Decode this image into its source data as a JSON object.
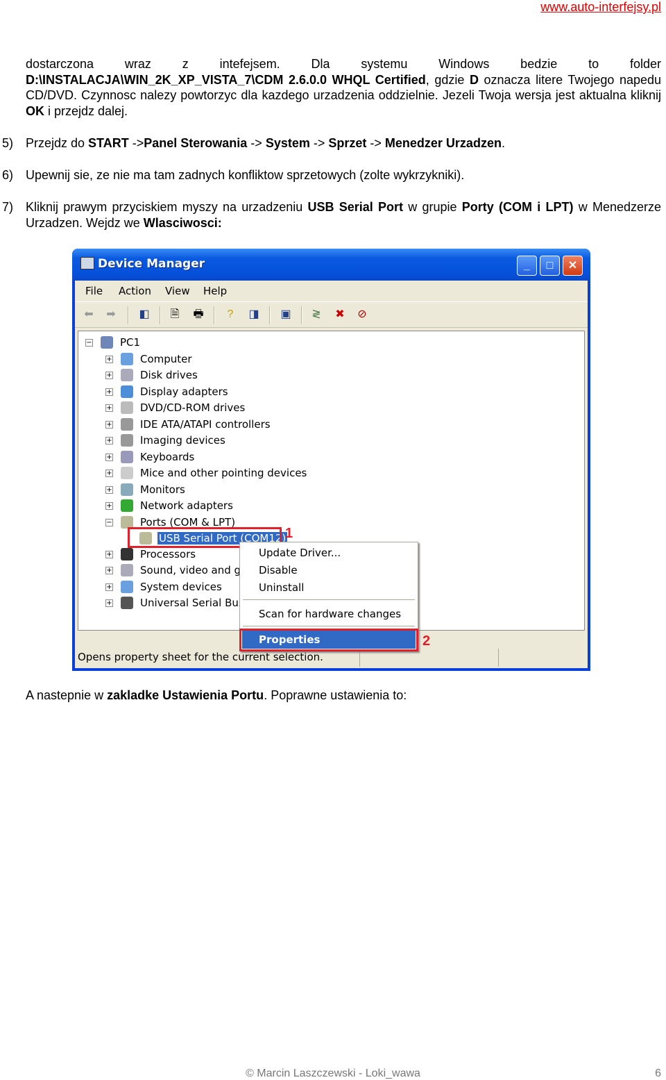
{
  "header": {
    "link": "www.auto-interfejsy.pl"
  },
  "paragraphs": [
    [
      {
        "t": "dostarczona wraz z intefejsem. Dla systemu Windows bedzie to folder "
      },
      {
        "t": "D:\\INSTALACJA\\WIN_2K_XP_VISTA_7\\CDM 2.6.0.0 WHQL Certified",
        "b": true
      },
      {
        "t": ", gdzie "
      },
      {
        "t": "D",
        "b": true
      },
      {
        "t": " oznacza litere Twojego napedu CD/DVD. Czynnosc nalezy powtorzyc dla kazdego urzadzenia oddzielnie. Jezeli Twoja wersja jest aktualna kliknij "
      },
      {
        "t": "OK",
        "b": true
      },
      {
        "t": " i przejdz dalej."
      }
    ]
  ],
  "steps": [
    {
      "num": "5)",
      "segs": [
        {
          "t": "Przejdz do "
        },
        {
          "t": "START",
          "b": true
        },
        {
          "t": " ->"
        },
        {
          "t": "Panel Sterowania ",
          "b": true
        },
        {
          "t": " -> "
        },
        {
          "t": "System",
          "b": true
        },
        {
          "t": " -> "
        },
        {
          "t": "Sprzet",
          "b": true
        },
        {
          "t": " -> "
        },
        {
          "t": "Menedzer Urzadzen",
          "b": true
        },
        {
          "t": "."
        }
      ]
    },
    {
      "num": "6)",
      "segs": [
        {
          "t": "Upewnij sie, ze nie ma tam zadnych konfliktow sprzetowych (zolte wykrzykniki)."
        }
      ]
    },
    {
      "num": "7)",
      "segs": [
        {
          "t": "Kliknij prawym przyciskiem myszy na urzadzeniu "
        },
        {
          "t": "USB Serial Port",
          "b": true
        },
        {
          "t": " w grupie "
        },
        {
          "t": "Porty (COM i LPT)",
          "b": true
        },
        {
          "t": " w Menedzerze Urzadzen. Wejdz we "
        },
        {
          "t": "Wlasciwosci:",
          "b": true
        }
      ]
    }
  ],
  "window": {
    "title": "Device Manager",
    "menu": [
      "File",
      "Action",
      "View",
      "Help"
    ],
    "toolbar_icons": [
      "back-arrow-icon",
      "forward-arrow-icon",
      "show-hide-tree-icon",
      "properties-icon",
      "print-icon",
      "help-icon",
      "show-hide-action-pane-icon",
      "update-driver-icon",
      "scan-hardware-icon",
      "uninstall-icon",
      "disable-icon"
    ],
    "tree_root": "PC1",
    "tree": [
      "Computer",
      "Disk drives",
      "Display adapters",
      "DVD/CD-ROM drives",
      "IDE ATA/ATAPI controllers",
      "Imaging devices",
      "Keyboards",
      "Mice and other pointing devices",
      "Monitors",
      "Network adapters",
      "Ports (COM & LPT)"
    ],
    "selected": "USB Serial Port (COM12)",
    "tree_after": [
      "Processors",
      "Sound, video and ga",
      "System devices",
      "Universal Serial Bus c"
    ],
    "context_menu": [
      "Update Driver...",
      "Disable",
      "Uninstall",
      "Scan for hardware changes",
      "Properties"
    ],
    "status": "Opens property sheet for the current selection.",
    "markers": [
      "1",
      "2"
    ],
    "colors": {
      "title_bar": "#0a5ae0",
      "highlight": "#316ac5",
      "marker": "#e0202a"
    }
  },
  "after": [
    {
      "t": "A nastepnie w "
    },
    {
      "t": "zakladke Ustawienia Portu",
      "b": true
    },
    {
      "t": ". Poprawne ustawienia to:"
    }
  ],
  "footer": {
    "text": "© Marcin Laszczewski - Loki_wawa",
    "page": "6"
  }
}
